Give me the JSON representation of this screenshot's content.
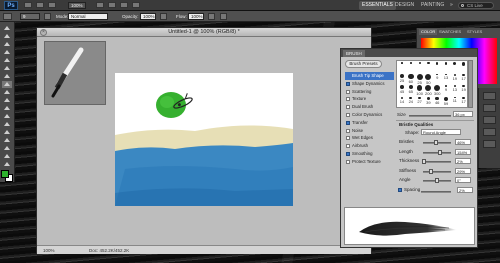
{
  "app": {
    "logo": "Ps",
    "view_zoom": "100%",
    "workspaces": [
      "ESSENTIALS",
      "DESIGN",
      "PAINTING"
    ],
    "more_workspaces": "»",
    "search": "CS Live"
  },
  "options_bar": {
    "brush_size": "9",
    "mode_label": "Mode:",
    "mode_value": "Normal",
    "opacity_label": "Opacity:",
    "opacity_value": "100%",
    "flow_label": "Flow:",
    "flow_value": "100%"
  },
  "document": {
    "title": "Untitled-1 @ 100% (RGB/8) *",
    "zoom": "100%",
    "doc_info": "Doc: 452.2K/452.2K"
  },
  "brush_panel": {
    "tab": "BRUSH",
    "presets_button": "Brush Presets",
    "options": [
      {
        "label": "Brush Tip Shape",
        "checkbox": false,
        "checked": false,
        "selected": true
      },
      {
        "label": "Shape Dynamics",
        "checkbox": true,
        "checked": true,
        "selected": false
      },
      {
        "label": "Scattering",
        "checkbox": true,
        "checked": false,
        "selected": false
      },
      {
        "label": "Texture",
        "checkbox": true,
        "checked": false,
        "selected": false
      },
      {
        "label": "Dual Brush",
        "checkbox": true,
        "checked": false,
        "selected": false
      },
      {
        "label": "Color Dynamics",
        "checkbox": true,
        "checked": false,
        "selected": false
      },
      {
        "label": "Transfer",
        "checkbox": true,
        "checked": true,
        "selected": false
      },
      {
        "label": "Noise",
        "checkbox": true,
        "checked": false,
        "selected": false
      },
      {
        "label": "Wet Edges",
        "checkbox": true,
        "checked": false,
        "selected": false
      },
      {
        "label": "Airbrush",
        "checkbox": true,
        "checked": false,
        "selected": false
      },
      {
        "label": "Smoothing",
        "checkbox": true,
        "checked": true,
        "selected": false
      },
      {
        "label": "Protect Texture",
        "checkbox": true,
        "checked": false,
        "selected": false
      }
    ],
    "size_label": "Size",
    "size_value": "36 px",
    "bristle_title": "Bristle Qualities",
    "shape_label": "Shape:",
    "shape_value": "Round Angle",
    "sliders": [
      {
        "label": "Bristles",
        "value": "46%",
        "fraction": 0.46
      },
      {
        "label": "Length",
        "value": "154%",
        "fraction": 0.6
      },
      {
        "label": "Thickness",
        "value": "2%",
        "fraction": 0.05
      },
      {
        "label": "Stiffness",
        "value": "29%",
        "fraction": 0.29
      },
      {
        "label": "Angle",
        "value": "0°",
        "fraction": 0.5
      }
    ],
    "spacing_label": "Spacing",
    "spacing_value": "2%",
    "tips": [
      {
        "size": 5,
        "label": ""
      },
      {
        "size": 9,
        "label": ""
      },
      {
        "size": 13,
        "label": ""
      },
      {
        "size": 17,
        "label": ""
      },
      {
        "size": 21,
        "label": ""
      },
      {
        "size": 27,
        "label": ""
      },
      {
        "size": 35,
        "label": ""
      },
      {
        "size": 45,
        "label": ""
      },
      {
        "size": 65,
        "label": "25"
      },
      {
        "size": 100,
        "label": "60"
      },
      {
        "size": 200,
        "label": "25"
      },
      {
        "size": 300,
        "label": "50"
      },
      {
        "size": 9,
        "label": "9"
      },
      {
        "size": 13,
        "label": "13"
      },
      {
        "size": 19,
        "label": "19"
      },
      {
        "size": 17,
        "label": "17"
      },
      {
        "size": 45,
        "label": "45"
      },
      {
        "size": 65,
        "label": "65"
      },
      {
        "size": 100,
        "label": "100"
      },
      {
        "size": 200,
        "label": "200"
      },
      {
        "size": 300,
        "label": "300"
      },
      {
        "size": 9,
        "label": "9"
      },
      {
        "size": 13,
        "label": "13"
      },
      {
        "size": 19,
        "label": "19"
      },
      {
        "size": 14,
        "label": "14"
      },
      {
        "size": 24,
        "label": "24"
      },
      {
        "size": 27,
        "label": "27"
      },
      {
        "size": 39,
        "label": "39"
      },
      {
        "size": 46,
        "label": "46"
      },
      {
        "size": 59,
        "label": "59"
      },
      {
        "size": 11,
        "label": "11"
      },
      {
        "size": 17,
        "label": "17"
      }
    ]
  },
  "color_panel": {
    "tabs": [
      "COLOR",
      "SWATCHES",
      "STYLES"
    ]
  },
  "colors": {
    "fg": "#2db12d",
    "bg": "#ffffff",
    "panel_select": "#3b73c6"
  }
}
